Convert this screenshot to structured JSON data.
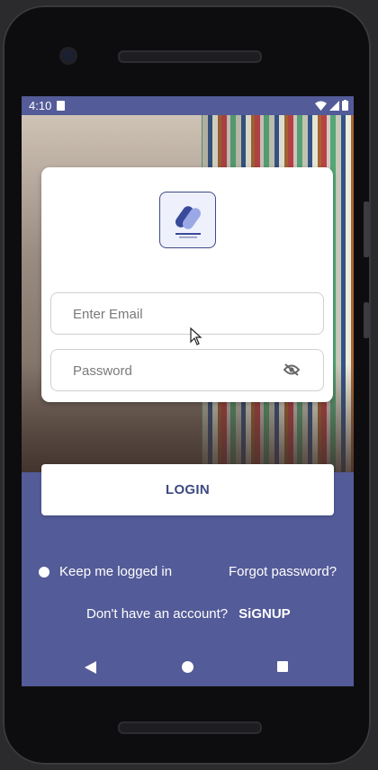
{
  "statusbar": {
    "time": "4:10"
  },
  "login_card": {
    "logo_icon": "app-logo-icon",
    "email": {
      "placeholder": "Enter Email",
      "value": ""
    },
    "password": {
      "placeholder": "Password",
      "value": "",
      "toggle_icon": "eye-off-icon"
    }
  },
  "actions": {
    "login_label": "LOGIN",
    "keep_logged_in_label": "Keep me logged in",
    "forgot_password_label": "Forgot password?",
    "no_account_text": "Don't have an account?",
    "signup_label": "SiGNUP"
  },
  "colors": {
    "primary": "#535b98",
    "button_text": "#3d4a82"
  }
}
